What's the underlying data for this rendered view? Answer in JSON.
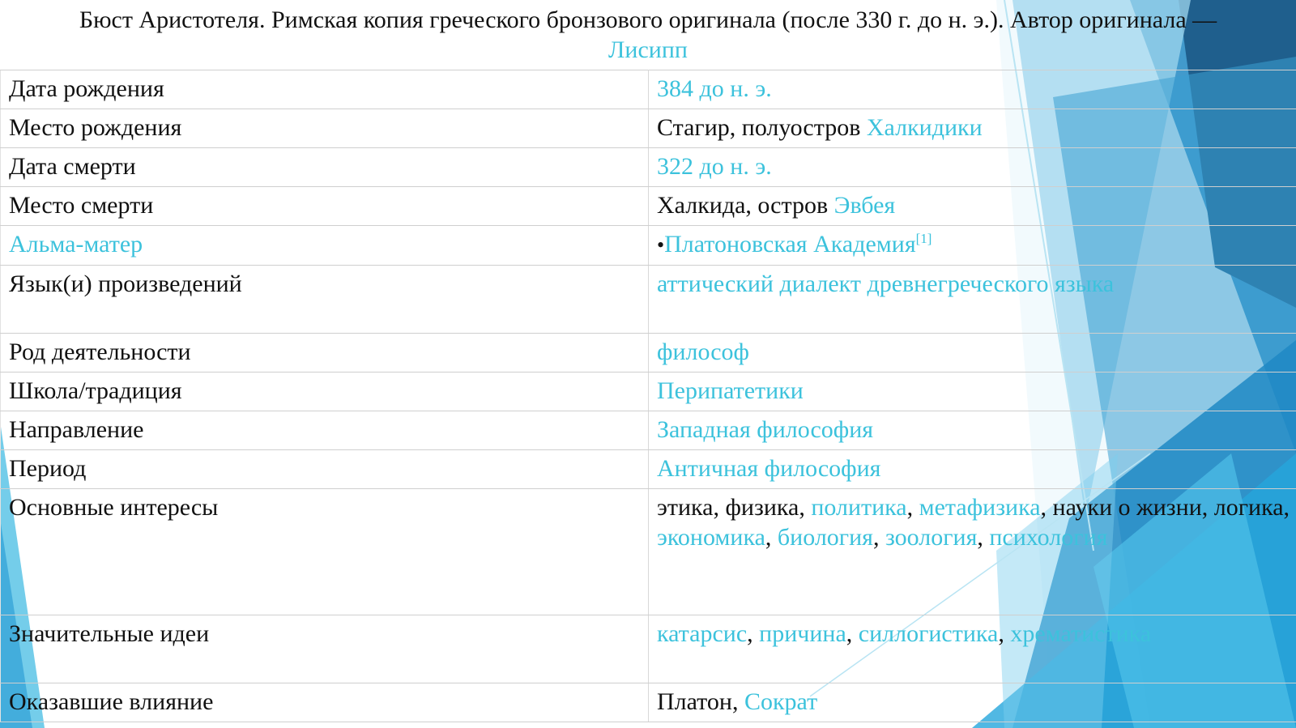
{
  "caption": {
    "text": "Бюст Аристотеля. Римская копия греческого бронзового оригинала (после 330 г. до н. э.). Автор оригинала —",
    "link": "Лисипп"
  },
  "rows": [
    {
      "label": "Дата рождения",
      "value": [
        {
          "text": "384 до н. э.",
          "link": true
        }
      ]
    },
    {
      "label": "Место рождения",
      "value": [
        {
          "text": "Стагир, полуостров ",
          "link": false
        },
        {
          "text": "Халкидики",
          "link": true
        }
      ]
    },
    {
      "label": "Дата смерти",
      "value": [
        {
          "text": "322 до н. э.",
          "link": true
        }
      ]
    },
    {
      "label": "Место смерти",
      "value": [
        {
          "text": "Халкида, остров ",
          "link": false
        },
        {
          "text": "Эвбея",
          "link": true
        }
      ]
    },
    {
      "label": "Альма-матер",
      "label_link": true,
      "value": [
        {
          "text": "•",
          "link": false
        },
        {
          "text": "Платоновская Академия",
          "link": true
        }
      ],
      "sup": "[1]"
    },
    {
      "label": "Язык(и) произведений",
      "value": [
        {
          "text": "аттический диалект древнегреческого языка",
          "link": true
        }
      ],
      "height": 84
    },
    {
      "label": "Род деятельности",
      "value": [
        {
          "text": "философ",
          "link": true
        }
      ]
    },
    {
      "label": "Школа/традиция",
      "value": [
        {
          "text": "Перипатетики",
          "link": true
        }
      ]
    },
    {
      "label": "Направление",
      "value": [
        {
          "text": "Западная философия",
          "link": true
        }
      ]
    },
    {
      "label": "Период",
      "value": [
        {
          "text": "Античная философия",
          "link": true
        }
      ]
    },
    {
      "label": "Основные интересы",
      "value": [
        {
          "text": "этика, физика, ",
          "link": false
        },
        {
          "text": "политика",
          "link": true
        },
        {
          "text": ", ",
          "link": false
        },
        {
          "text": "метафизика",
          "link": true
        },
        {
          "text": ", науки о жизни, логика, ",
          "link": false
        },
        {
          "text": "экономика",
          "link": true
        },
        {
          "text": ", ",
          "link": false
        },
        {
          "text": "биология",
          "link": true
        },
        {
          "text": ", ",
          "link": false
        },
        {
          "text": "зоология",
          "link": true
        },
        {
          "text": ", ",
          "link": false
        },
        {
          "text": "психология",
          "link": true
        }
      ],
      "height": 160
    },
    {
      "label": "Значительные идеи",
      "value": [
        {
          "text": "катарсис",
          "link": true
        },
        {
          "text": ", ",
          "link": false
        },
        {
          "text": "причина",
          "link": true
        },
        {
          "text": ", ",
          "link": false
        },
        {
          "text": "силлогистика",
          "link": true
        },
        {
          "text": ", ",
          "link": false
        },
        {
          "text": "хрематистика",
          "link": true
        }
      ],
      "height": 86
    },
    {
      "label": "Оказавшие влияние",
      "value": [
        {
          "text": "Платон",
          "link": false
        },
        {
          "text": ", ",
          "link": false
        },
        {
          "text": "Сократ",
          "link": true
        }
      ]
    }
  ],
  "colors": {
    "link": "#3cc2dc",
    "text": "#111111",
    "accent_dark": "#1e5f8c",
    "accent_mid": "#2b8ec4",
    "accent_light": "#5cc4e6"
  }
}
